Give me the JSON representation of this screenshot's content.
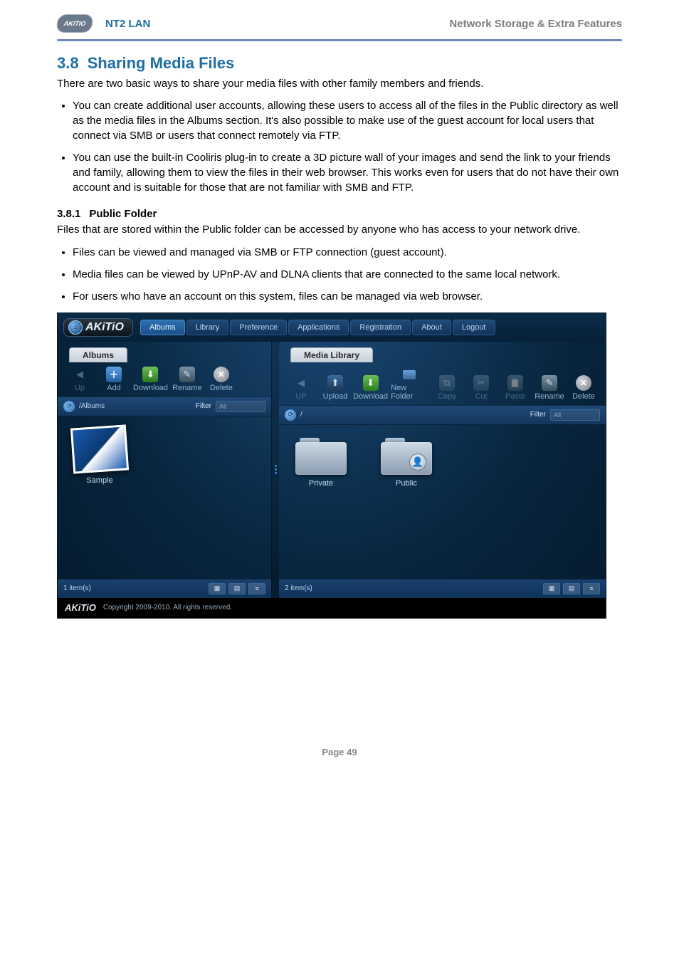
{
  "header": {
    "product": "NT2 LAN",
    "section": "Network Storage & Extra Features",
    "logo_text": "AKITIO"
  },
  "section": {
    "number": "3.8",
    "title": "Sharing Media Files",
    "intro": "There are two basic ways to share your media files with other family members and friends.",
    "bullets": [
      "You can create additional user accounts, allowing these users to access all of the files in the Public directory as well as the media files in the Albums section. It's also possible to make use of the guest account for local users that connect via SMB or users that connect remotely via FTP.",
      "You can use the built-in Cooliris plug-in to create a 3D picture wall of your images and send the link to your friends and family, allowing them to view the files in their web browser. This works even for users that do not have their own account and is suitable for those that are not familiar with SMB and FTP."
    ]
  },
  "subsection": {
    "number": "3.8.1",
    "title": "Public Folder",
    "intro": "Files that are stored within the Public folder can be accessed by anyone who has access to your network drive.",
    "bullets": [
      "Files can be viewed and managed via SMB or FTP connection (guest account).",
      "Media files can be viewed by UPnP-AV and DLNA clients that are connected to the same local network.",
      "For users who have an account on this system, files can be managed via web browser."
    ]
  },
  "app": {
    "logo": "AKiTiO",
    "nav": {
      "albums": "Albums",
      "library": "Library",
      "preference": "Preference",
      "applications": "Applications",
      "registration": "Registration",
      "about": "About",
      "logout": "Logout"
    },
    "albums_panel": {
      "title": "Albums",
      "toolbar": {
        "up": "Up",
        "add": "Add",
        "download": "Download",
        "rename": "Rename",
        "delete": "Delete"
      },
      "crumb": "/Albums",
      "filter_label": "Filter",
      "filter_hint": "All",
      "items": [
        {
          "label": "Sample",
          "kind": "album"
        }
      ],
      "status": "1 item(s)"
    },
    "media_panel": {
      "title": "Media Library",
      "toolbar": {
        "up": "UP",
        "upload": "Upload",
        "download": "Download",
        "newfolder": "New Folder",
        "copy": "Copy",
        "cut": "Cut",
        "paste": "Paste",
        "rename": "Rename",
        "delete": "Delete"
      },
      "crumb": "/",
      "filter_label": "Filter",
      "filter_hint": "All",
      "items": [
        {
          "label": "Private",
          "kind": "folder"
        },
        {
          "label": "Public",
          "kind": "folder-public"
        }
      ],
      "status": "2 item(s)"
    },
    "footer": {
      "logo": "AKiTiO",
      "copyright": "Copyright 2009-2010. All rights reserved."
    }
  },
  "page_footer": "Page 49"
}
